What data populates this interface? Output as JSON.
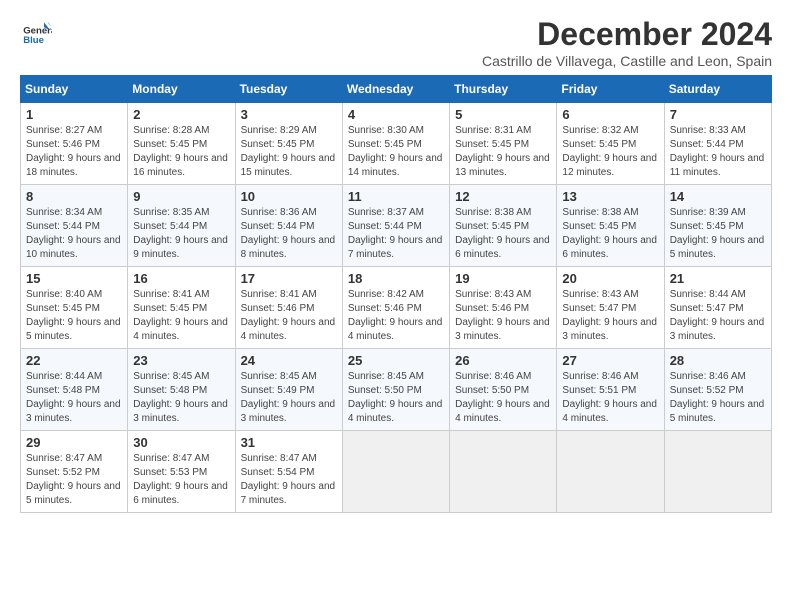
{
  "logo": {
    "general": "General",
    "blue": "Blue"
  },
  "title": "December 2024",
  "location": "Castrillo de Villavega, Castille and Leon, Spain",
  "days_of_week": [
    "Sunday",
    "Monday",
    "Tuesday",
    "Wednesday",
    "Thursday",
    "Friday",
    "Saturday"
  ],
  "weeks": [
    [
      {
        "day": "1",
        "sunrise": "8:27 AM",
        "sunset": "5:46 PM",
        "daylight": "9 hours and 18 minutes."
      },
      {
        "day": "2",
        "sunrise": "8:28 AM",
        "sunset": "5:45 PM",
        "daylight": "9 hours and 16 minutes."
      },
      {
        "day": "3",
        "sunrise": "8:29 AM",
        "sunset": "5:45 PM",
        "daylight": "9 hours and 15 minutes."
      },
      {
        "day": "4",
        "sunrise": "8:30 AM",
        "sunset": "5:45 PM",
        "daylight": "9 hours and 14 minutes."
      },
      {
        "day": "5",
        "sunrise": "8:31 AM",
        "sunset": "5:45 PM",
        "daylight": "9 hours and 13 minutes."
      },
      {
        "day": "6",
        "sunrise": "8:32 AM",
        "sunset": "5:45 PM",
        "daylight": "9 hours and 12 minutes."
      },
      {
        "day": "7",
        "sunrise": "8:33 AM",
        "sunset": "5:44 PM",
        "daylight": "9 hours and 11 minutes."
      }
    ],
    [
      {
        "day": "8",
        "sunrise": "8:34 AM",
        "sunset": "5:44 PM",
        "daylight": "9 hours and 10 minutes."
      },
      {
        "day": "9",
        "sunrise": "8:35 AM",
        "sunset": "5:44 PM",
        "daylight": "9 hours and 9 minutes."
      },
      {
        "day": "10",
        "sunrise": "8:36 AM",
        "sunset": "5:44 PM",
        "daylight": "9 hours and 8 minutes."
      },
      {
        "day": "11",
        "sunrise": "8:37 AM",
        "sunset": "5:44 PM",
        "daylight": "9 hours and 7 minutes."
      },
      {
        "day": "12",
        "sunrise": "8:38 AM",
        "sunset": "5:45 PM",
        "daylight": "9 hours and 6 minutes."
      },
      {
        "day": "13",
        "sunrise": "8:38 AM",
        "sunset": "5:45 PM",
        "daylight": "9 hours and 6 minutes."
      },
      {
        "day": "14",
        "sunrise": "8:39 AM",
        "sunset": "5:45 PM",
        "daylight": "9 hours and 5 minutes."
      }
    ],
    [
      {
        "day": "15",
        "sunrise": "8:40 AM",
        "sunset": "5:45 PM",
        "daylight": "9 hours and 5 minutes."
      },
      {
        "day": "16",
        "sunrise": "8:41 AM",
        "sunset": "5:45 PM",
        "daylight": "9 hours and 4 minutes."
      },
      {
        "day": "17",
        "sunrise": "8:41 AM",
        "sunset": "5:46 PM",
        "daylight": "9 hours and 4 minutes."
      },
      {
        "day": "18",
        "sunrise": "8:42 AM",
        "sunset": "5:46 PM",
        "daylight": "9 hours and 4 minutes."
      },
      {
        "day": "19",
        "sunrise": "8:43 AM",
        "sunset": "5:46 PM",
        "daylight": "9 hours and 3 minutes."
      },
      {
        "day": "20",
        "sunrise": "8:43 AM",
        "sunset": "5:47 PM",
        "daylight": "9 hours and 3 minutes."
      },
      {
        "day": "21",
        "sunrise": "8:44 AM",
        "sunset": "5:47 PM",
        "daylight": "9 hours and 3 minutes."
      }
    ],
    [
      {
        "day": "22",
        "sunrise": "8:44 AM",
        "sunset": "5:48 PM",
        "daylight": "9 hours and 3 minutes."
      },
      {
        "day": "23",
        "sunrise": "8:45 AM",
        "sunset": "5:48 PM",
        "daylight": "9 hours and 3 minutes."
      },
      {
        "day": "24",
        "sunrise": "8:45 AM",
        "sunset": "5:49 PM",
        "daylight": "9 hours and 3 minutes."
      },
      {
        "day": "25",
        "sunrise": "8:45 AM",
        "sunset": "5:50 PM",
        "daylight": "9 hours and 4 minutes."
      },
      {
        "day": "26",
        "sunrise": "8:46 AM",
        "sunset": "5:50 PM",
        "daylight": "9 hours and 4 minutes."
      },
      {
        "day": "27",
        "sunrise": "8:46 AM",
        "sunset": "5:51 PM",
        "daylight": "9 hours and 4 minutes."
      },
      {
        "day": "28",
        "sunrise": "8:46 AM",
        "sunset": "5:52 PM",
        "daylight": "9 hours and 5 minutes."
      }
    ],
    [
      {
        "day": "29",
        "sunrise": "8:47 AM",
        "sunset": "5:52 PM",
        "daylight": "9 hours and 5 minutes."
      },
      {
        "day": "30",
        "sunrise": "8:47 AM",
        "sunset": "5:53 PM",
        "daylight": "9 hours and 6 minutes."
      },
      {
        "day": "31",
        "sunrise": "8:47 AM",
        "sunset": "5:54 PM",
        "daylight": "9 hours and 7 minutes."
      },
      null,
      null,
      null,
      null
    ]
  ]
}
